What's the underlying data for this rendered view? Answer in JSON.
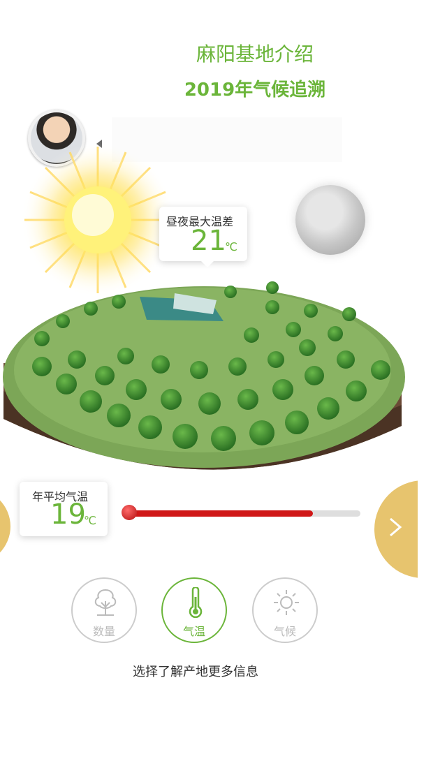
{
  "header": {
    "title": "麻阳基地介绍",
    "subtitle": "2019年气候追溯"
  },
  "stats": {
    "max_diff": {
      "label": "昼夜最大温差",
      "value": "21",
      "unit": "℃"
    },
    "avg_temp": {
      "label": "年平均气温",
      "value": "19",
      "unit": "℃"
    }
  },
  "thermometer": {
    "level_fraction": 0.8,
    "fill_color": "#d01818"
  },
  "nav": {
    "items": [
      {
        "label": "数量",
        "icon": "tree-icon",
        "active": false
      },
      {
        "label": "气温",
        "icon": "thermometer-icon",
        "active": true
      },
      {
        "label": "气候",
        "icon": "sun-icon",
        "active": false
      }
    ]
  },
  "hint": "选择了解产地更多信息",
  "colors": {
    "accent": "#6bb53a",
    "arrow": "#e7c46e"
  }
}
